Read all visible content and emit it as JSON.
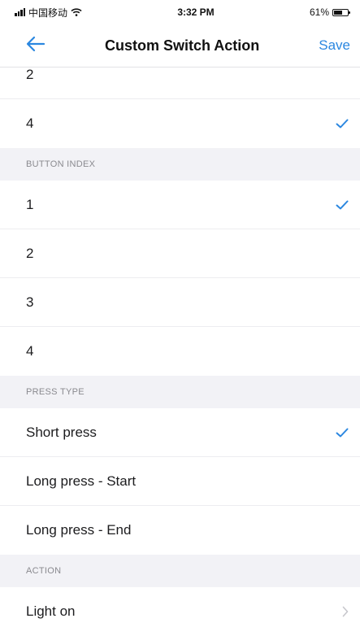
{
  "status_bar": {
    "carrier": "中国移动",
    "time": "3:32 PM",
    "battery": "61%",
    "battery_level": 0.61
  },
  "nav": {
    "title": "Custom Switch Action",
    "save_label": "Save"
  },
  "colors": {
    "accent": "#2b87e0",
    "section_bg": "#f2f2f6",
    "section_text": "#8a8a8f"
  },
  "top_list": [
    {
      "label": "2",
      "checked": false
    },
    {
      "label": "4",
      "checked": true
    }
  ],
  "button_index": {
    "header": "BUTTON INDEX",
    "items": [
      {
        "label": "1",
        "checked": true
      },
      {
        "label": "2",
        "checked": false
      },
      {
        "label": "3",
        "checked": false
      },
      {
        "label": "4",
        "checked": false
      }
    ]
  },
  "press_type": {
    "header": "PRESS TYPE",
    "items": [
      {
        "label": "Short press",
        "checked": true
      },
      {
        "label": "Long press - Start",
        "checked": false
      },
      {
        "label": "Long press - End",
        "checked": false
      }
    ]
  },
  "action": {
    "header": "ACTION",
    "items": [
      {
        "label": "Light on",
        "icon": "chevron-right-icon"
      }
    ]
  }
}
